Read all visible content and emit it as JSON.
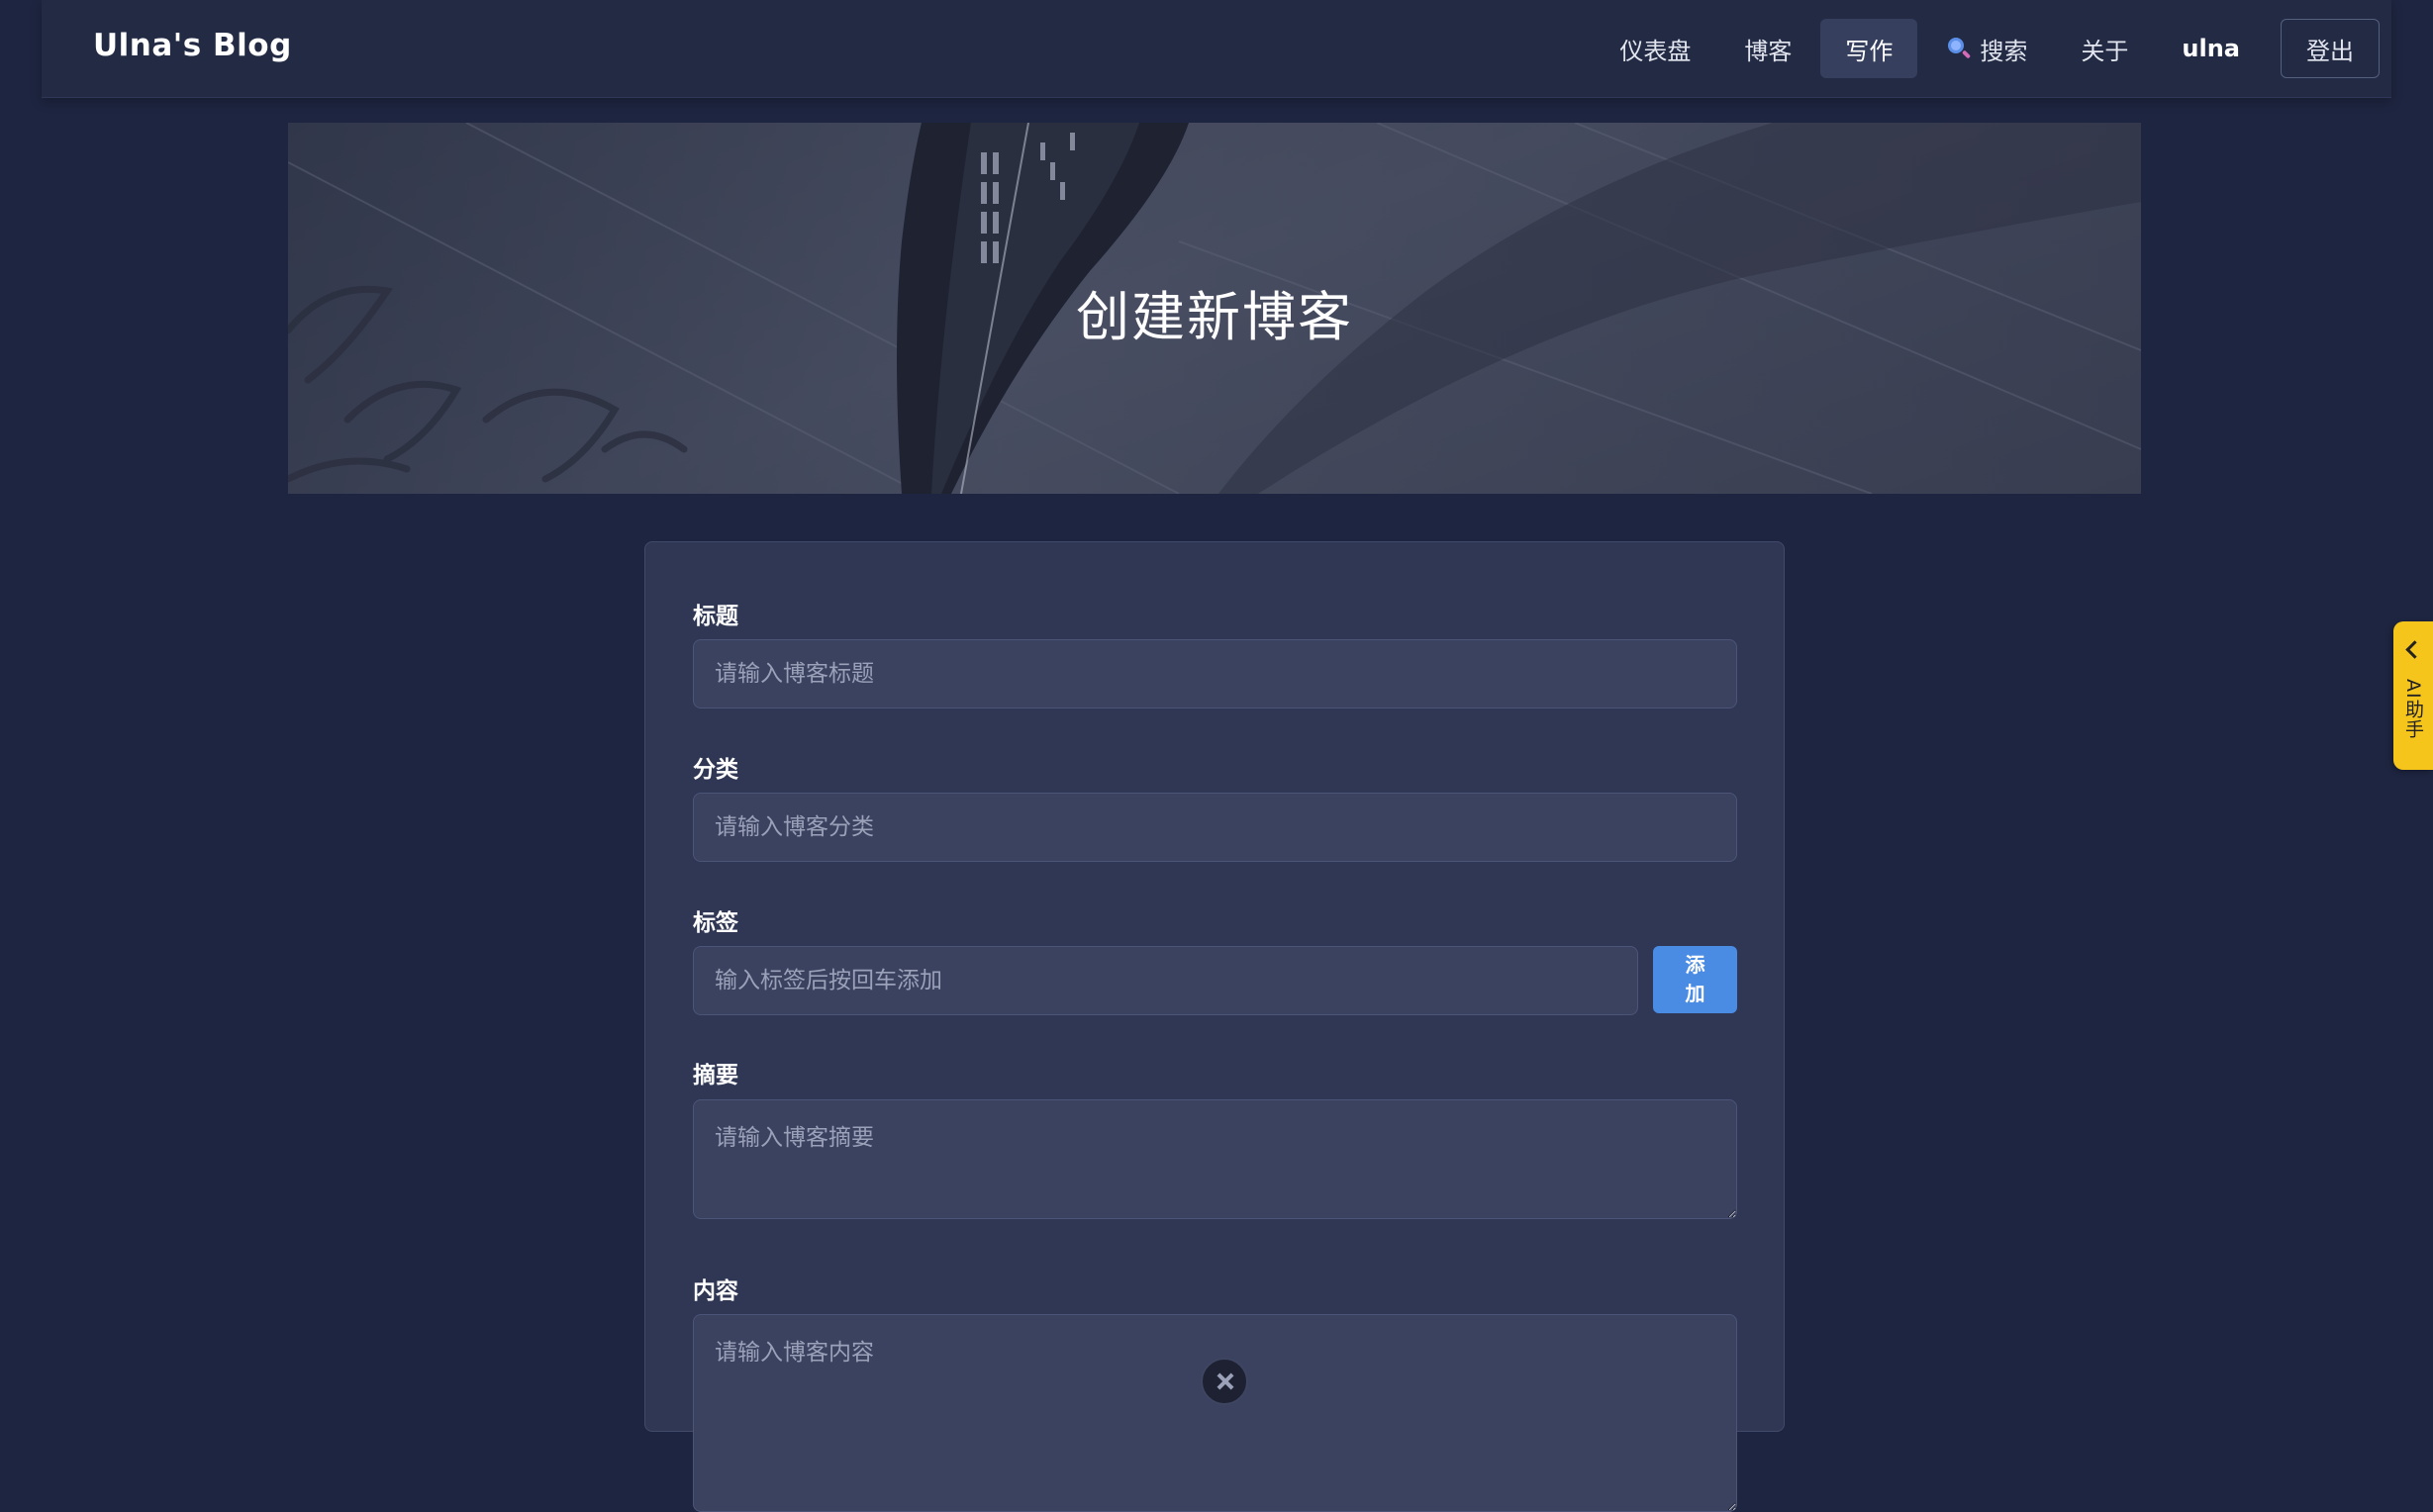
{
  "navbar": {
    "brand": "Ulna's Blog",
    "items": [
      {
        "label": "仪表盘"
      },
      {
        "label": "博客"
      },
      {
        "label": "写作"
      },
      {
        "label": "搜索",
        "icon": "search-icon"
      },
      {
        "label": "关于"
      },
      {
        "label": "ulna"
      },
      {
        "label": "登出"
      }
    ],
    "active": "写作"
  },
  "hero": {
    "title": "创建新博客"
  },
  "form": {
    "title": {
      "label": "标题",
      "placeholder": "请输入博客标题",
      "value": ""
    },
    "category": {
      "label": "分类",
      "placeholder": "请输入博客分类",
      "value": ""
    },
    "tags": {
      "label": "标签",
      "placeholder": "输入标签后按回车添加",
      "value": "",
      "add_label": "添加"
    },
    "summary": {
      "label": "摘要",
      "placeholder": "请输入博客摘要",
      "value": ""
    },
    "content": {
      "label": "内容",
      "placeholder": "请输入博客内容",
      "value": ""
    }
  },
  "ai_tab": {
    "label": "AI助手",
    "icon": "chevron-left-icon",
    "color": "#f5c51c"
  },
  "colors": {
    "background": "#1e2540",
    "card": "#2f3754",
    "accent": "#4a8be3"
  }
}
